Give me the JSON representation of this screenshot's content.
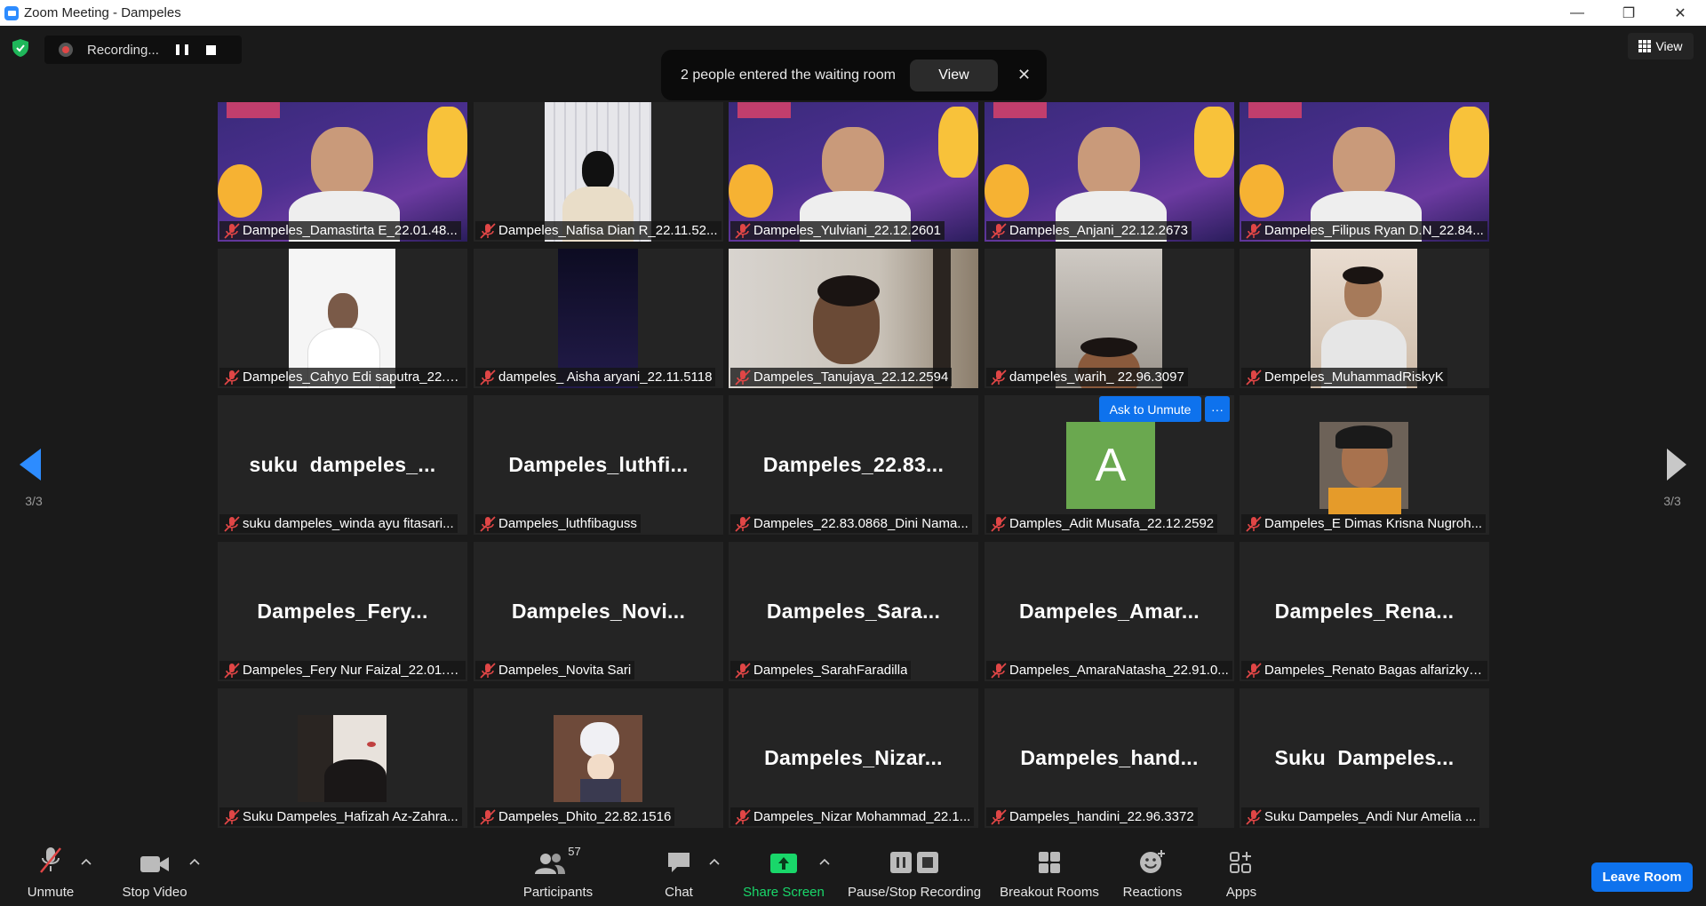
{
  "window": {
    "title": "Zoom Meeting - Dampeles",
    "minimize": "—",
    "restore": "❐",
    "close": "✕"
  },
  "recording": {
    "label": "Recording..."
  },
  "view_button": {
    "label": "View"
  },
  "notification": {
    "text": "2 people entered the waiting room",
    "view_label": "View",
    "close": "✕"
  },
  "pagination": {
    "left": "3/3",
    "right": "3/3"
  },
  "ask_unmute": {
    "label": "Ask to Unmute",
    "more": "···"
  },
  "avatar_letter": "A",
  "tiles": [
    {
      "name": "Dampeles_Damastirta E_22.01.48...",
      "type": "video",
      "scene": "banner"
    },
    {
      "name": "Dampeles_Nafisa Dian R_22.11.52...",
      "type": "video",
      "scene": "curtain"
    },
    {
      "name": "Dampeles_Yulviani_22.12.2601",
      "type": "video",
      "scene": "banner"
    },
    {
      "name": "Dampeles_Anjani_22.12.2673",
      "type": "video",
      "scene": "banner"
    },
    {
      "name": "Dampeles_Filipus Ryan D.N_22.84...",
      "type": "video",
      "scene": "banner"
    },
    {
      "name": "Dampeles_Cahyo Edi saputra_22.0...",
      "type": "video",
      "scene": "white"
    },
    {
      "name": "dampeles_ Aisha aryani_22.11.5118",
      "type": "video",
      "scene": "night"
    },
    {
      "name": "Dampeles_Tanujaya_22.12.2594",
      "type": "video",
      "scene": "room"
    },
    {
      "name": "dampeles_warih_ 22.96.3097",
      "type": "video",
      "scene": "ceiling"
    },
    {
      "name": "Dempeles_MuhammadRiskyK",
      "type": "video",
      "scene": "hoodie"
    },
    {
      "name": "suku dampeles_winda ayu fitasari...",
      "type": "text",
      "display": "suku  dampeles_..."
    },
    {
      "name": "Dampeles_luthfibaguss",
      "type": "text",
      "display": "Dampeles_luthfi..."
    },
    {
      "name": "Dampeles_22.83.0868_Dini Nama...",
      "type": "text",
      "display": "Dampeles_22.83..."
    },
    {
      "name": "Damples_Adit Musafa_22.12.2592",
      "type": "avatar"
    },
    {
      "name": "Dampeles_E Dimas Krisna Nugroh...",
      "type": "video",
      "scene": "cap"
    },
    {
      "name": "Dampeles_Fery Nur Faizal_22.01.4...",
      "type": "text",
      "display": "Dampeles_Fery..."
    },
    {
      "name": "Dampeles_Novita Sari",
      "type": "text",
      "display": "Dampeles_Novi..."
    },
    {
      "name": "Dampeles_SarahFaradilla",
      "type": "text",
      "display": "Dampeles_Sara..."
    },
    {
      "name": "Dampeles_AmaraNatasha_22.91.0...",
      "type": "text",
      "display": "Dampeles_Amar..."
    },
    {
      "name": "Dampeles_Renato Bagas alfarizky_...",
      "type": "text",
      "display": "Dampeles_Rena..."
    },
    {
      "name": "Suku Dampeles_Hafizah Az-Zahra...",
      "type": "video",
      "scene": "hijab"
    },
    {
      "name": "Dampeles_Dhito_22.82.1516",
      "type": "video",
      "scene": "anime"
    },
    {
      "name": "Dampeles_Nizar Mohammad_22.1...",
      "type": "text",
      "display": "Dampeles_Nizar..."
    },
    {
      "name": "Dampeles_handini_22.96.3372",
      "type": "text",
      "display": "Dampeles_hand..."
    },
    {
      "name": "Suku Dampeles_Andi Nur Amelia ...",
      "type": "text",
      "display": "Suku  Dampeles..."
    }
  ],
  "toolbar": {
    "unmute": "Unmute",
    "stop_video": "Stop Video",
    "participants": "Participants",
    "participants_count": "57",
    "chat": "Chat",
    "share_screen": "Share Screen",
    "pause_stop_recording": "Pause/Stop Recording",
    "breakout_rooms": "Breakout Rooms",
    "reactions": "Reactions",
    "apps": "Apps",
    "leave_room": "Leave Room"
  },
  "colors": {
    "accent": "#0e72ed",
    "share_green": "#19d76a",
    "mic_off_red": "#e04646",
    "avatar_green": "#6aa84f"
  }
}
